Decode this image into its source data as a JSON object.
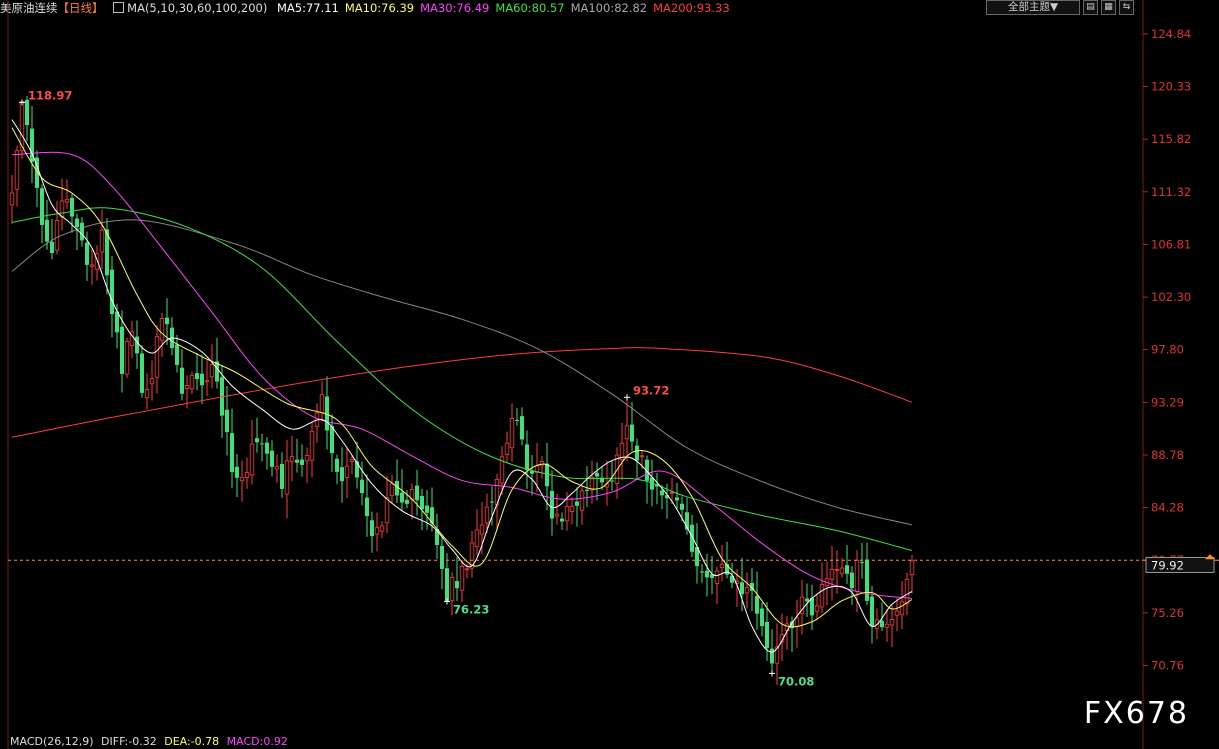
{
  "header": {
    "symbol": "美原油连续",
    "period": "【日线】",
    "ma_params": "MA(5,10,30,60,100,200)",
    "ma_items": [
      {
        "label": "MA5:77.11",
        "color": "#ffffff"
      },
      {
        "label": "MA10:76.39",
        "color": "#ffff4d"
      },
      {
        "label": "MA30:76.49",
        "color": "#ff40ff"
      },
      {
        "label": "MA60:80.57",
        "color": "#40e040"
      },
      {
        "label": "MA100:82.82",
        "color": "#a8a8a8"
      },
      {
        "label": "MA200:93.33",
        "color": "#ff3b3b"
      }
    ]
  },
  "toolbar": {
    "theme_dropdown": "全部主题▼",
    "buttons": [
      "▤",
      "▦",
      "⇆"
    ]
  },
  "watermark": "FX678",
  "footer": {
    "macd": "MACD(26,12,9)",
    "diff": "DIFF:-0.32",
    "dea": "DEA:-0.78",
    "macd_val": "MACD:0.92"
  },
  "chart_data": {
    "type": "candlestick",
    "y_ticks": [
      124.84,
      120.33,
      115.82,
      111.32,
      106.81,
      102.3,
      97.8,
      93.29,
      88.78,
      84.28,
      79.77,
      75.26,
      70.76
    ],
    "ylim": [
      67.8,
      126.2
    ],
    "current_price": 79.92,
    "current_price_line": 79.77,
    "annotations": [
      {
        "text": "118.97",
        "idx": 2,
        "value": 118.97,
        "kind": "high"
      },
      {
        "text": "76.23",
        "idx": 87,
        "value": 76.23,
        "kind": "low"
      },
      {
        "text": "93.72",
        "idx": 123,
        "value": 93.72,
        "kind": "high"
      },
      {
        "text": "70.08",
        "idx": 152,
        "value": 70.08,
        "kind": "low"
      }
    ],
    "ma_lines": [
      {
        "name": "MA200",
        "color": "#ff3b3b",
        "pts": [
          [
            0,
            90.3
          ],
          [
            20,
            92.0
          ],
          [
            40,
            93.6
          ],
          [
            60,
            95.1
          ],
          [
            80,
            96.4
          ],
          [
            100,
            97.4
          ],
          [
            120,
            97.9
          ],
          [
            130,
            97.9
          ],
          [
            150,
            97.2
          ],
          [
            165,
            95.6
          ],
          [
            180,
            93.3
          ]
        ]
      },
      {
        "name": "MA100",
        "color": "#a8a8a8",
        "pts": [
          [
            0,
            104.5
          ],
          [
            10,
            107.6
          ],
          [
            25,
            108.9
          ],
          [
            45,
            106.8
          ],
          [
            60,
            104.2
          ],
          [
            75,
            102.2
          ],
          [
            90,
            100.4
          ],
          [
            105,
            97.9
          ],
          [
            120,
            94.0
          ],
          [
            135,
            89.4
          ],
          [
            150,
            86.5
          ],
          [
            165,
            84.3
          ],
          [
            180,
            82.8
          ]
        ]
      },
      {
        "name": "MA60",
        "color": "#40e040",
        "pts": [
          [
            0,
            108.7
          ],
          [
            10,
            109.5
          ],
          [
            20,
            109.9
          ],
          [
            35,
            108.3
          ],
          [
            50,
            104.8
          ],
          [
            65,
            98.5
          ],
          [
            80,
            92.7
          ],
          [
            95,
            88.8
          ],
          [
            110,
            86.9
          ],
          [
            125,
            86.7
          ],
          [
            135,
            85.2
          ],
          [
            150,
            83.6
          ],
          [
            165,
            82.3
          ],
          [
            180,
            80.6
          ]
        ]
      },
      {
        "name": "MA30",
        "color": "#ff40ff",
        "pts": [
          [
            0,
            114.5
          ],
          [
            12,
            114.5
          ],
          [
            20,
            111.8
          ],
          [
            30,
            106.5
          ],
          [
            40,
            101.0
          ],
          [
            50,
            95.5
          ],
          [
            60,
            92.1
          ],
          [
            70,
            91.0
          ],
          [
            80,
            88.7
          ],
          [
            90,
            86.6
          ],
          [
            100,
            86.0
          ],
          [
            110,
            85.0
          ],
          [
            120,
            85.6
          ],
          [
            130,
            87.4
          ],
          [
            140,
            84.6
          ],
          [
            150,
            81.2
          ],
          [
            160,
            78.4
          ],
          [
            170,
            77.0
          ],
          [
            180,
            76.5
          ]
        ]
      },
      {
        "name": "MA10",
        "color": "#ffff4d",
        "pts": [
          [
            0,
            116.8
          ],
          [
            6,
            112.5
          ],
          [
            12,
            111.2
          ],
          [
            18,
            108.5
          ],
          [
            25,
            102.5
          ],
          [
            30,
            99.2
          ],
          [
            38,
            97.2
          ],
          [
            45,
            95.8
          ],
          [
            55,
            93.2
          ],
          [
            65,
            91.8
          ],
          [
            72,
            87.8
          ],
          [
            80,
            85.0
          ],
          [
            88,
            81.0
          ],
          [
            94,
            79.5
          ],
          [
            100,
            85.8
          ],
          [
            106,
            88.0
          ],
          [
            112,
            86.5
          ],
          [
            118,
            86.0
          ],
          [
            124,
            89.0
          ],
          [
            130,
            88.4
          ],
          [
            136,
            85.2
          ],
          [
            142,
            79.9
          ],
          [
            148,
            77.4
          ],
          [
            154,
            74.3
          ],
          [
            160,
            74.5
          ],
          [
            166,
            76.3
          ],
          [
            172,
            77.0
          ],
          [
            176,
            75.6
          ],
          [
            180,
            76.4
          ]
        ]
      },
      {
        "name": "MA5",
        "color": "#ffffff",
        "pts": [
          [
            0,
            117.5
          ],
          [
            4,
            114.6
          ],
          [
            8,
            110.2
          ],
          [
            12,
            108.5
          ],
          [
            16,
            106.5
          ],
          [
            20,
            102.0
          ],
          [
            24,
            99.0
          ],
          [
            28,
            97.5
          ],
          [
            32,
            98.8
          ],
          [
            38,
            97.6
          ],
          [
            44,
            94.7
          ],
          [
            50,
            92.7
          ],
          [
            56,
            91.0
          ],
          [
            62,
            91.8
          ],
          [
            66,
            90.0
          ],
          [
            72,
            86.3
          ],
          [
            78,
            84.0
          ],
          [
            84,
            82.7
          ],
          [
            88,
            80.7
          ],
          [
            92,
            79.3
          ],
          [
            96,
            83.5
          ],
          [
            100,
            87.3
          ],
          [
            104,
            86.7
          ],
          [
            108,
            84.3
          ],
          [
            112,
            85.5
          ],
          [
            116,
            87.1
          ],
          [
            120,
            88.3
          ],
          [
            124,
            88.5
          ],
          [
            128,
            86.9
          ],
          [
            132,
            84.8
          ],
          [
            136,
            81.8
          ],
          [
            140,
            78.6
          ],
          [
            144,
            78.5
          ],
          [
            148,
            74.1
          ],
          [
            152,
            71.9
          ],
          [
            156,
            74.4
          ],
          [
            160,
            76.5
          ],
          [
            164,
            77.5
          ],
          [
            168,
            77.0
          ],
          [
            172,
            74.1
          ],
          [
            176,
            76.0
          ],
          [
            180,
            77.1
          ]
        ]
      }
    ]
  }
}
